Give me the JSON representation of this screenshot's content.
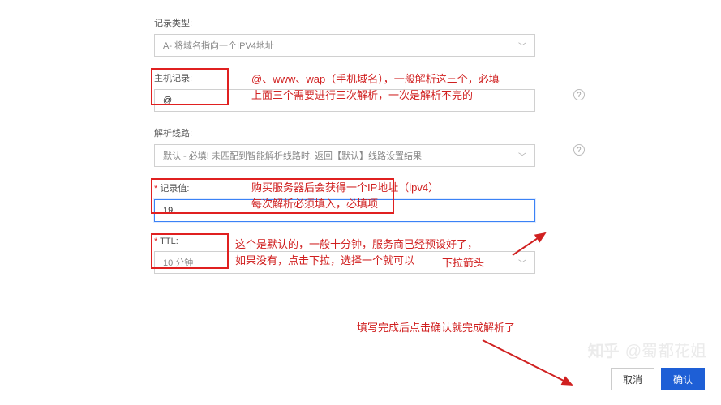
{
  "fields": {
    "recordType": {
      "label": "记录类型:",
      "value": "A- 将域名指向一个IPV4地址"
    },
    "hostRecord": {
      "label": "主机记录:",
      "value": "@"
    },
    "routeLine": {
      "label": "解析线路:",
      "value": "默认 - 必填! 未匹配到智能解析线路时,  返回【默认】线路设置结果"
    },
    "recordValue": {
      "label": "记录值:",
      "value": "19."
    },
    "ttl": {
      "label": "TTL:",
      "value": "10 分钟"
    }
  },
  "annotations": {
    "host1": "@、www、wap（手机域名），一般解析这三个，必填",
    "host2": "上面三个需要进行三次解析，一次是解析不完的",
    "value1": "购买服务器后会获得一个IP地址（ipv4）",
    "value2": "每次解析必须填入，必填项",
    "ttl1": "这个是默认的，一般十分钟，服务商已经预设好了，",
    "ttl2": "如果没有，点击下拉，选择一个就可以",
    "arrowLabel": "下拉箭头",
    "final": "填写完成后点击确认就完成解析了"
  },
  "buttons": {
    "cancel": "取消",
    "confirm": "确认"
  },
  "watermark": {
    "logo": "知乎",
    "author": "@蜀都花姐"
  }
}
